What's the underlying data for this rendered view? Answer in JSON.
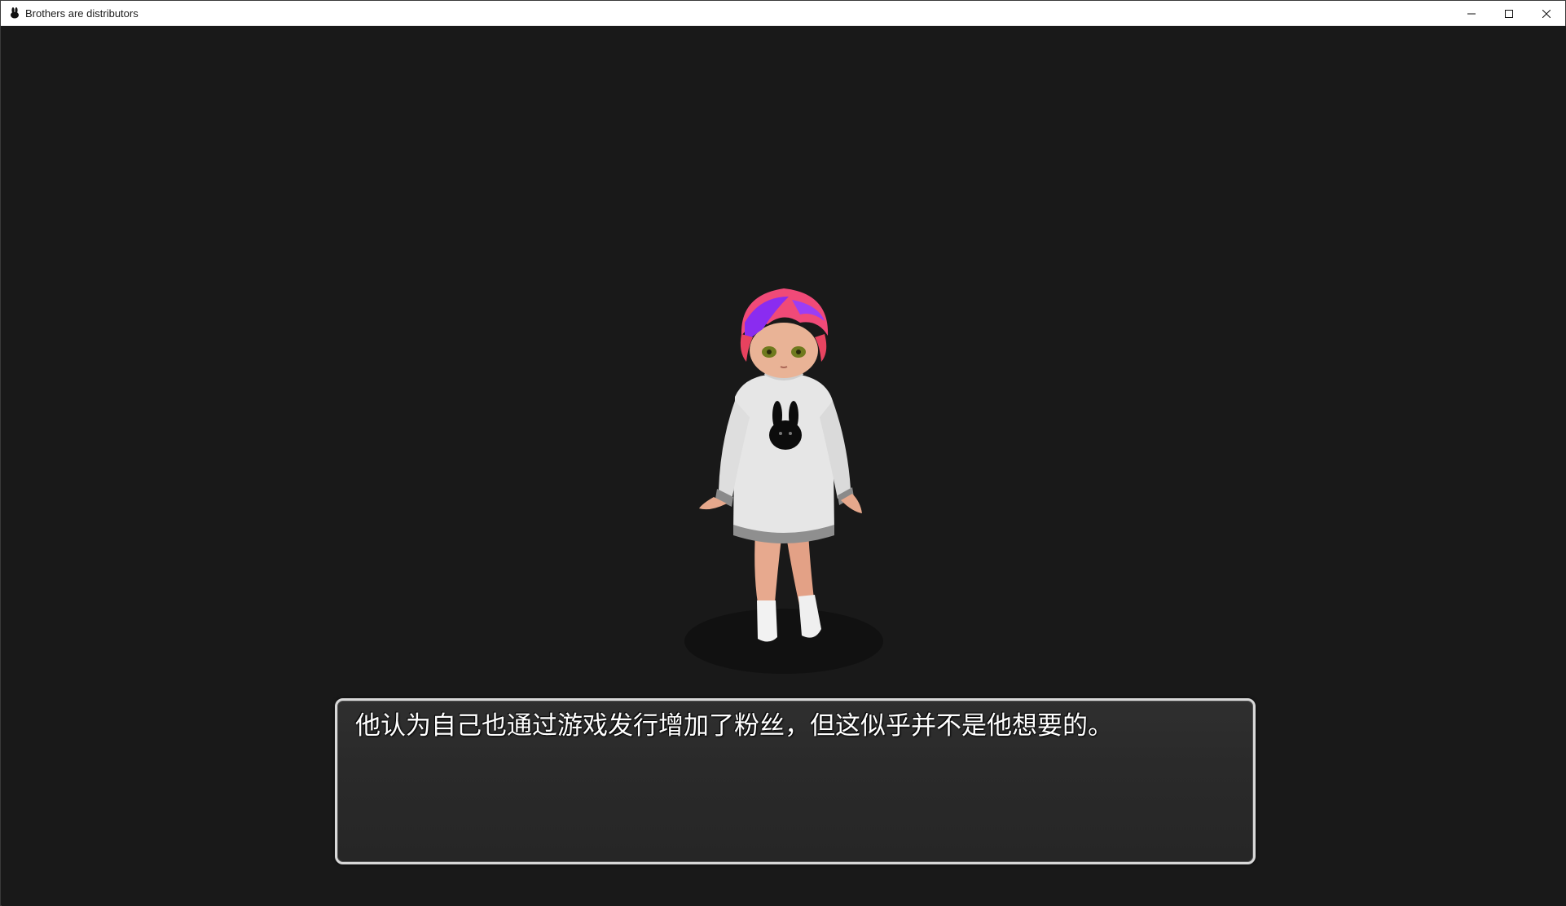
{
  "window": {
    "title": "Brothers are distributors",
    "app_icon": "rabbit-icon",
    "controls": {
      "minimize_icon": "minimize-icon",
      "maximize_icon": "maximize-icon",
      "close_icon": "close-icon"
    }
  },
  "scene": {
    "background_color": "#191919",
    "character": "chibi-character-white-sweater-rabbit-print"
  },
  "dialog": {
    "text": "他认为自己也通过游戏发行增加了粉丝，但这似乎并不是他想要的。"
  }
}
